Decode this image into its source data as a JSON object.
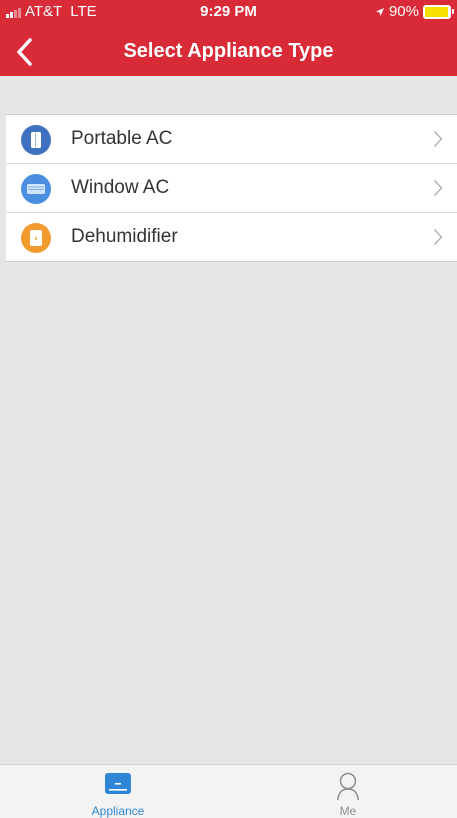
{
  "status_bar": {
    "carrier": "AT&T",
    "network": "LTE",
    "time": "9:29 PM",
    "battery": "90%",
    "battery_level": 0.9
  },
  "nav": {
    "title": "Select Appliance Type",
    "back_icon": "chevron-left-icon"
  },
  "appliance_types": [
    {
      "label": "Portable AC",
      "icon": "portable-ac-icon",
      "color": "#3f6fbf"
    },
    {
      "label": "Window AC",
      "icon": "window-ac-icon",
      "color": "#4a8ee0"
    },
    {
      "label": "Dehumidifier",
      "icon": "dehumidifier-icon",
      "color": "#f29a2e"
    }
  ],
  "tabbar": {
    "items": [
      {
        "label": "Appliance",
        "icon": "appliance-icon",
        "active": true
      },
      {
        "label": "Me",
        "icon": "user-icon",
        "active": false
      }
    ]
  },
  "colors": {
    "header": "#d92a37",
    "active_tab": "#2f86d6",
    "inactive_tab": "#8e8e8e",
    "background": "#e6e6e6"
  }
}
